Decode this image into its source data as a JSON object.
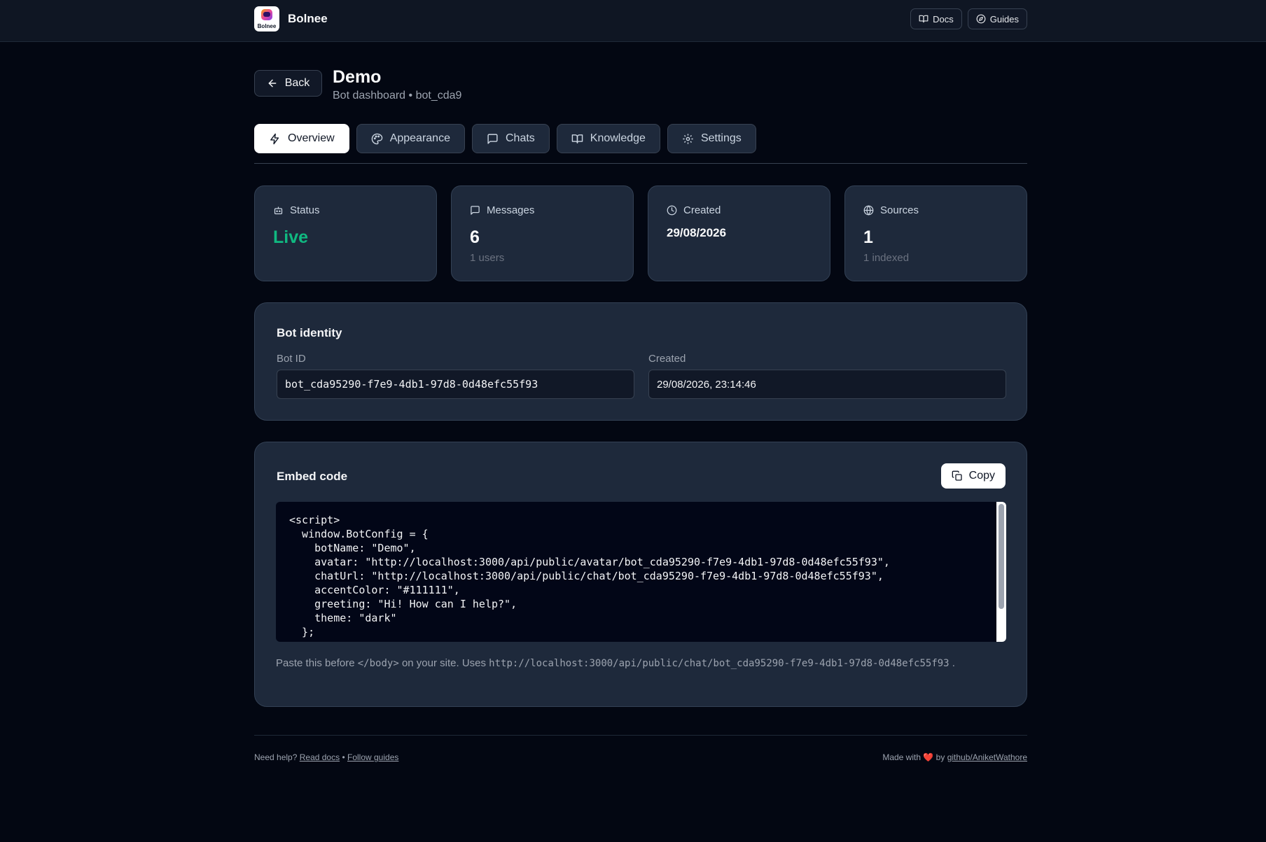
{
  "app": {
    "name": "Bolnee",
    "logo_text": "Bolnee",
    "docs_label": "Docs",
    "guides_label": "Guides"
  },
  "header": {
    "back_label": "Back",
    "title": "Demo",
    "subtitle": "Bot dashboard • bot_cda9"
  },
  "tabs": [
    {
      "label": "Overview",
      "icon": "bolt-icon",
      "active": true
    },
    {
      "label": "Appearance",
      "icon": "palette-icon",
      "active": false
    },
    {
      "label": "Chats",
      "icon": "chat-icon",
      "active": false
    },
    {
      "label": "Knowledge",
      "icon": "book-icon",
      "active": false
    },
    {
      "label": "Settings",
      "icon": "gear-icon",
      "active": false
    }
  ],
  "stats": {
    "status": {
      "label": "Status",
      "value": "Live",
      "icon": "bot-icon",
      "color": "#10b981"
    },
    "messages": {
      "label": "Messages",
      "value": "6",
      "note": "1 users",
      "icon": "message-icon"
    },
    "created": {
      "label": "Created",
      "value": "29/08/2026",
      "icon": "clock-icon"
    },
    "sources": {
      "label": "Sources",
      "value": "1",
      "note": "1 indexed",
      "icon": "globe-icon"
    }
  },
  "identity": {
    "title": "Bot identity",
    "bot_id_label": "Bot ID",
    "bot_id_value": "bot_cda95290-f7e9-4db1-97d8-0d48efc55f93",
    "created_label": "Created",
    "created_value": "29/08/2026, 23:14:46"
  },
  "embed": {
    "title": "Embed code",
    "copy_label": "Copy",
    "code": "<script>\n  window.BotConfig = {\n    botName: \"Demo\",\n    avatar: \"http://localhost:3000/api/public/avatar/bot_cda95290-f7e9-4db1-97d8-0d48efc55f93\",\n    chatUrl: \"http://localhost:3000/api/public/chat/bot_cda95290-f7e9-4db1-97d8-0d48efc55f93\",\n    accentColor: \"#111111\",\n    greeting: \"Hi! How can I help?\",\n    theme: \"dark\"\n  };",
    "hint_prefix": "Paste this before",
    "hint_tag": "</body>",
    "hint_middle": "on your site. Uses",
    "hint_url": "http://localhost:3000/api/public/chat/bot_cda95290-f7e9-4db1-97d8-0d48efc55f93",
    "hint_suffix": "."
  },
  "footer": {
    "need_help": "Need help?",
    "read_docs": "Read docs",
    "separator": "•",
    "follow_guides": "Follow guides",
    "made_with": "Made with",
    "heart": "❤️",
    "by": "by",
    "author_link": "github/AniketWathore"
  }
}
